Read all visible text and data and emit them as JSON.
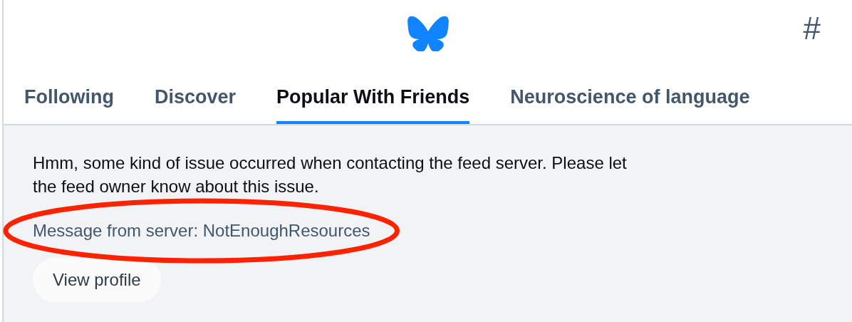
{
  "header": {
    "right_button": "#"
  },
  "tabs": [
    {
      "label": "Following",
      "selected": false
    },
    {
      "label": "Discover",
      "selected": false
    },
    {
      "label": "Popular With Friends",
      "selected": true
    },
    {
      "label": "Neuroscience of language",
      "selected": false
    }
  ],
  "error": {
    "message": "Hmm, some kind of issue occurred when contacting the feed server. Please let the feed owner know about this issue.",
    "server_message": "Message from server: NotEnoughResources",
    "button": "View profile"
  },
  "annotations": [
    {
      "kind": "ellipse"
    }
  ]
}
